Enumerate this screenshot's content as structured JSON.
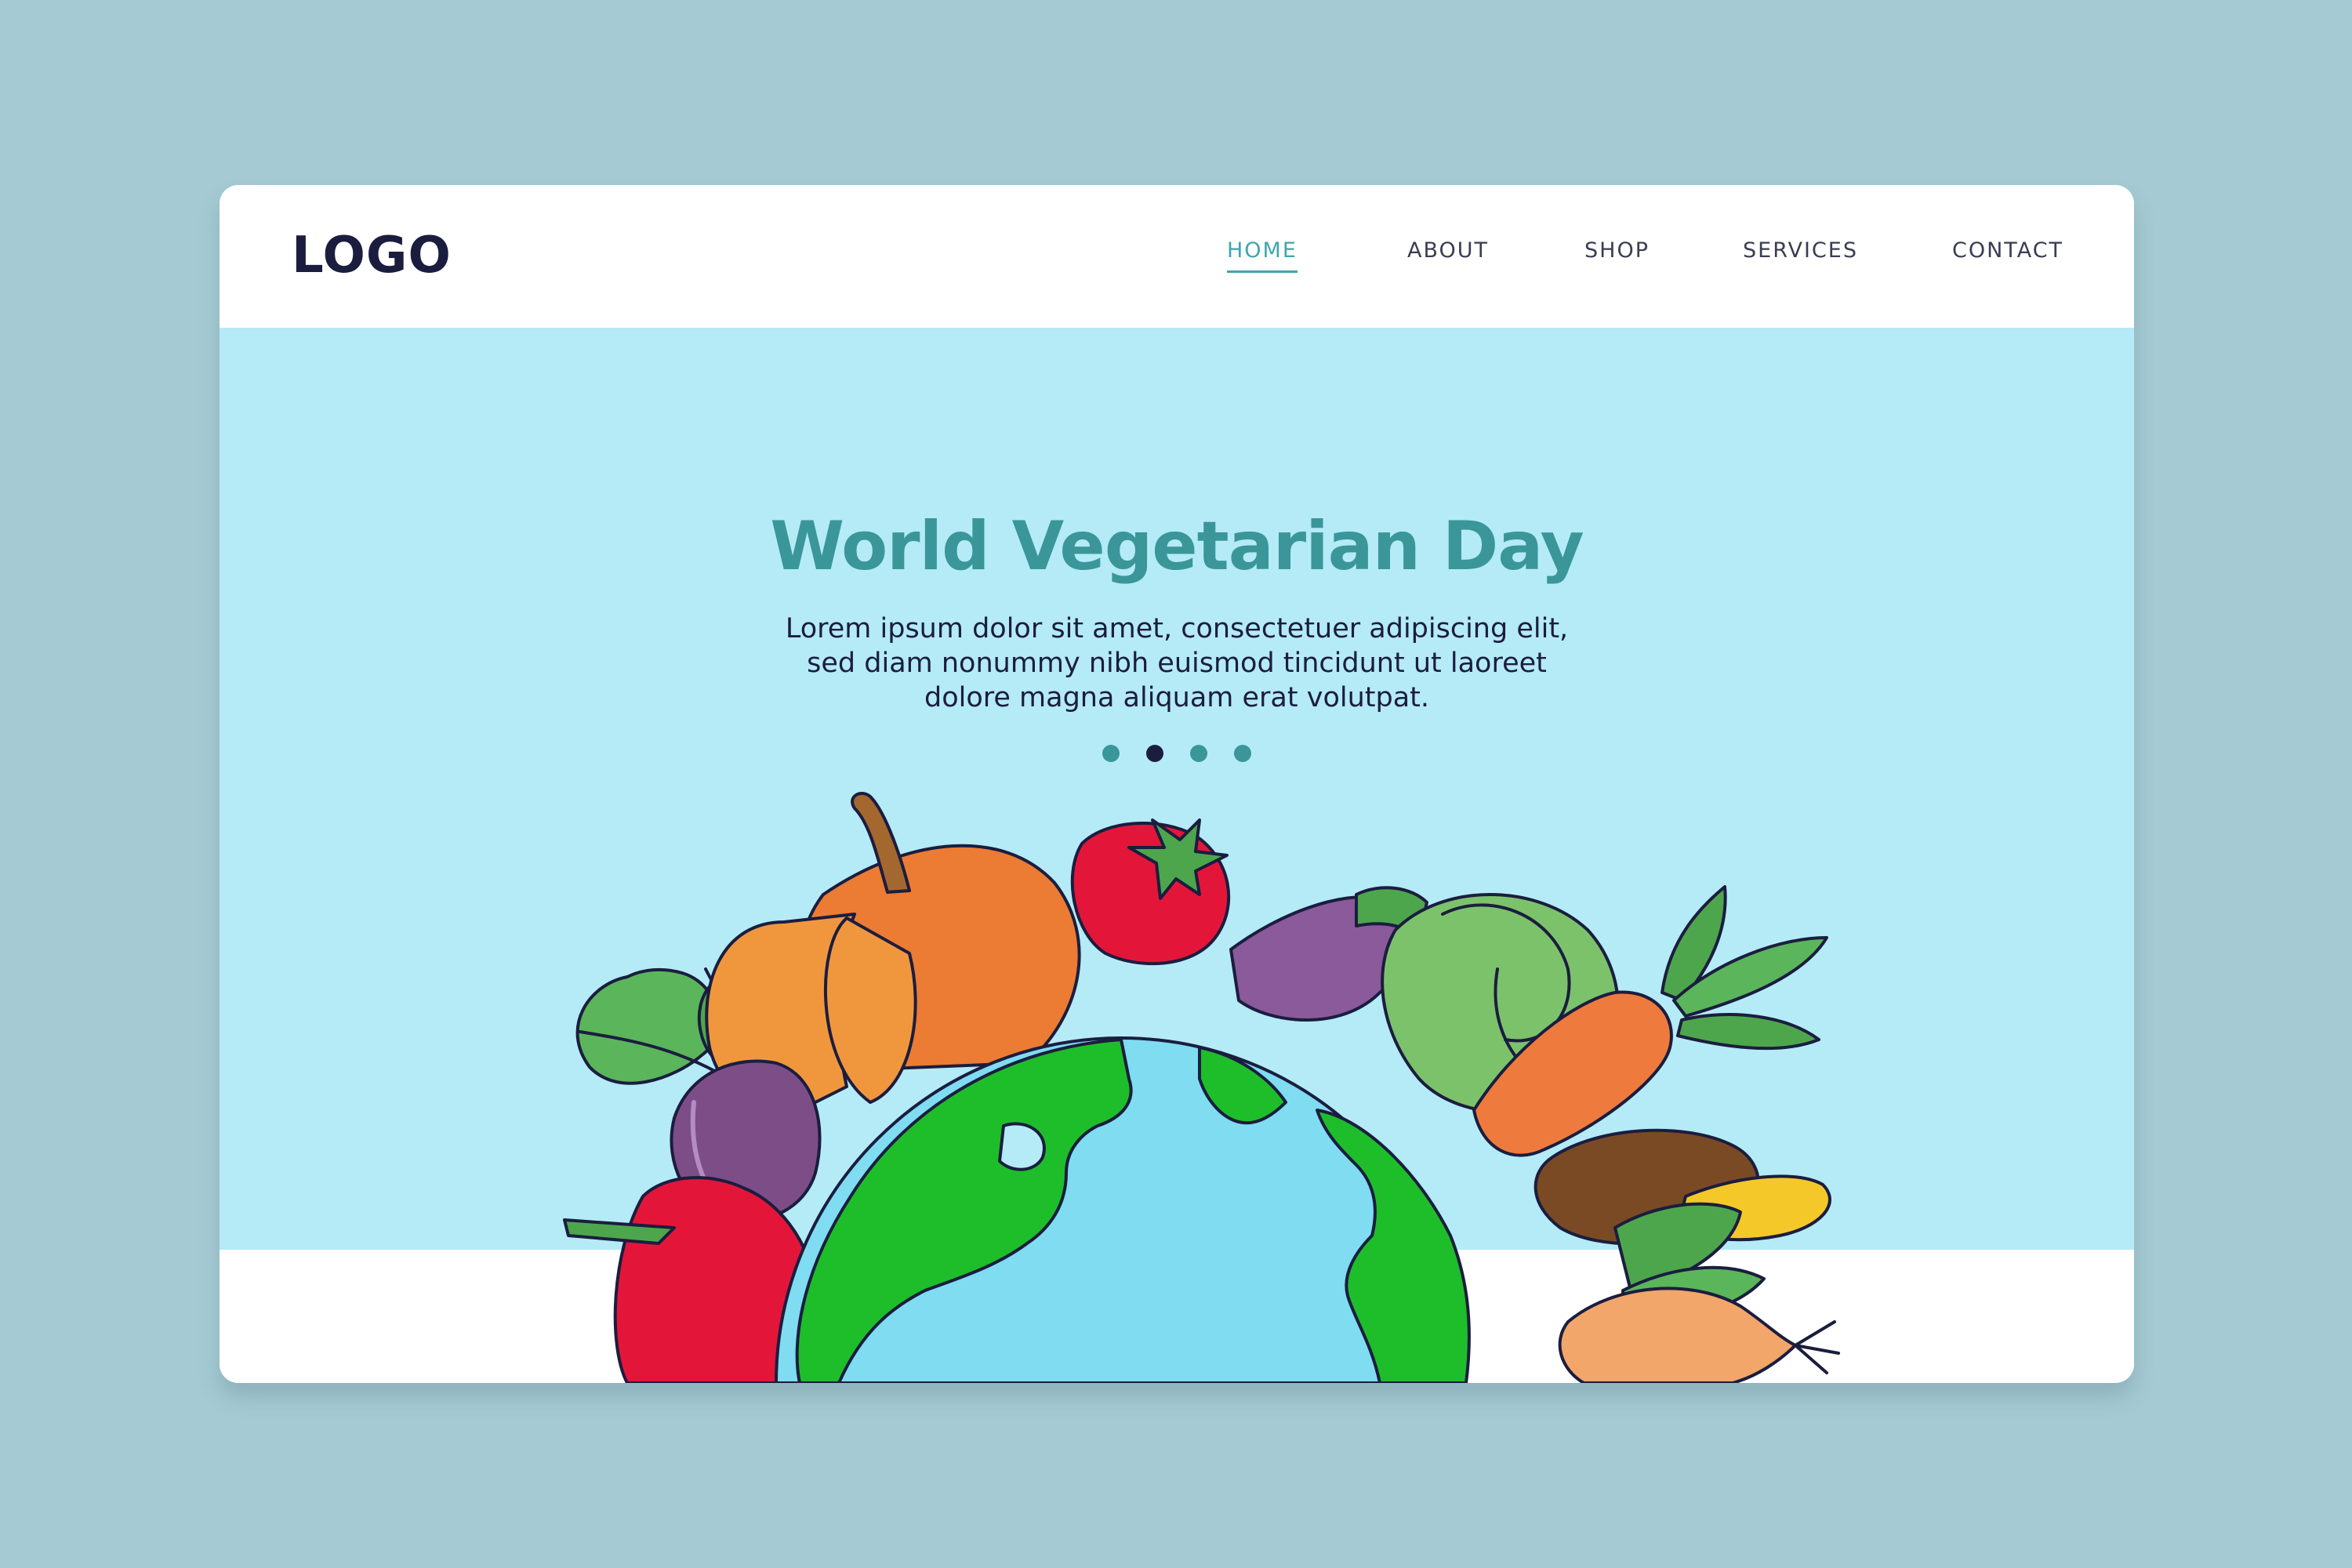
{
  "logo": "LOGO",
  "nav": {
    "items": [
      {
        "label": "HOME",
        "active": true
      },
      {
        "label": "ABOUT",
        "active": false
      },
      {
        "label": "SHOP",
        "active": false
      },
      {
        "label": "SERVICES",
        "active": false
      },
      {
        "label": "CONTACT",
        "active": false
      }
    ]
  },
  "hero": {
    "title": "World Vegetarian Day",
    "body": "Lorem ipsum dolor sit amet, consectetuer adipiscing elit, sed diam nonummy nibh euismod tincidunt ut laoreet dolore magna aliquam erat volutpat."
  },
  "carousel": {
    "count": 4,
    "active_index": 1
  },
  "colors": {
    "background": "#a5cad3",
    "hero_bg": "#b4ebf7",
    "accent": "#3a9699",
    "nav_active": "#3fa6ad",
    "text_dark": "#1b1d3f"
  }
}
